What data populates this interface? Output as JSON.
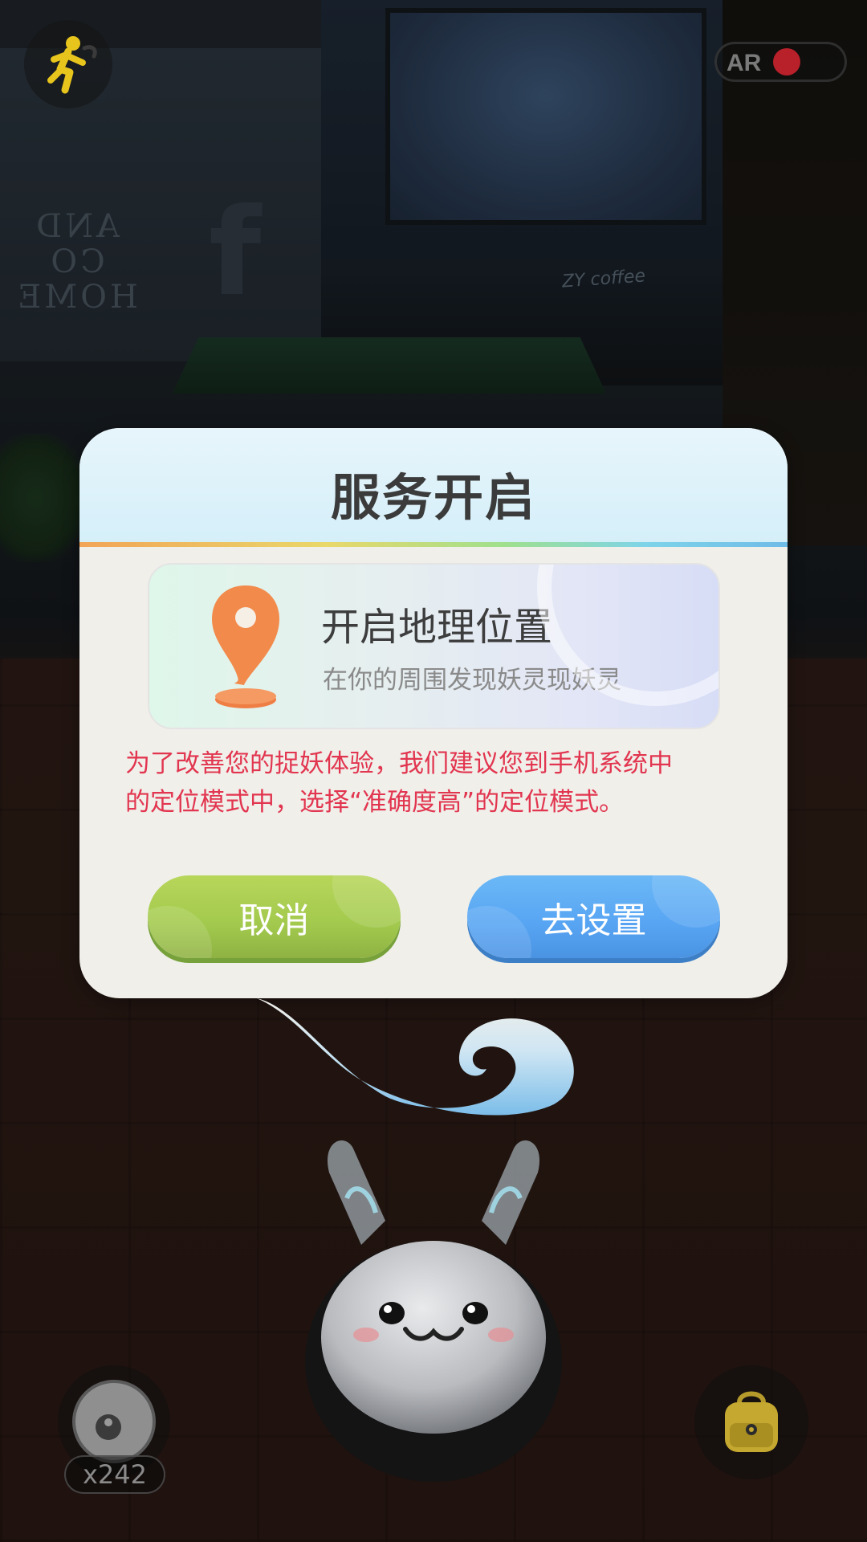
{
  "dialog": {
    "title": "服务开启",
    "card_title": "开启地理位置",
    "card_subtitle": "在你的周围发现妖灵现妖灵",
    "notice_line1": "为了改善您的捉妖体验，我们建议您到手机系统中",
    "notice_line2": "的定位模式中，选择“准确度高”的定位模式。",
    "cancel_label": "取消",
    "settings_label": "去设置"
  },
  "top": {
    "ar_label": "AR",
    "ar_enabled": false
  },
  "background": {
    "shop_sign": "AND CO HOME",
    "shop_letter": "f",
    "cafe_sign": "ZY coffee"
  },
  "bottom": {
    "ball_count": "x242"
  },
  "colors": {
    "title": "#3b3b3b",
    "notice": "#e2354f",
    "cancel_button": "#a2c94d",
    "settings_button": "#57a4f3",
    "pin": "#f28a4b"
  },
  "icons": [
    "running-man-icon",
    "location-pin-icon",
    "yin-yang-ball-icon",
    "backpack-icon"
  ]
}
